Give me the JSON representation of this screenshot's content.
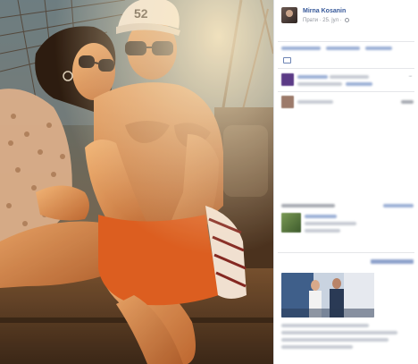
{
  "post": {
    "author": "Mirna Kosanin",
    "meta": "Прати · 25. јул ·"
  },
  "photo": {
    "description_icon": "photo-image"
  },
  "colors": {
    "name_link": "#365899",
    "meta_text": "#90949c",
    "divider": "#e5e6e9"
  }
}
